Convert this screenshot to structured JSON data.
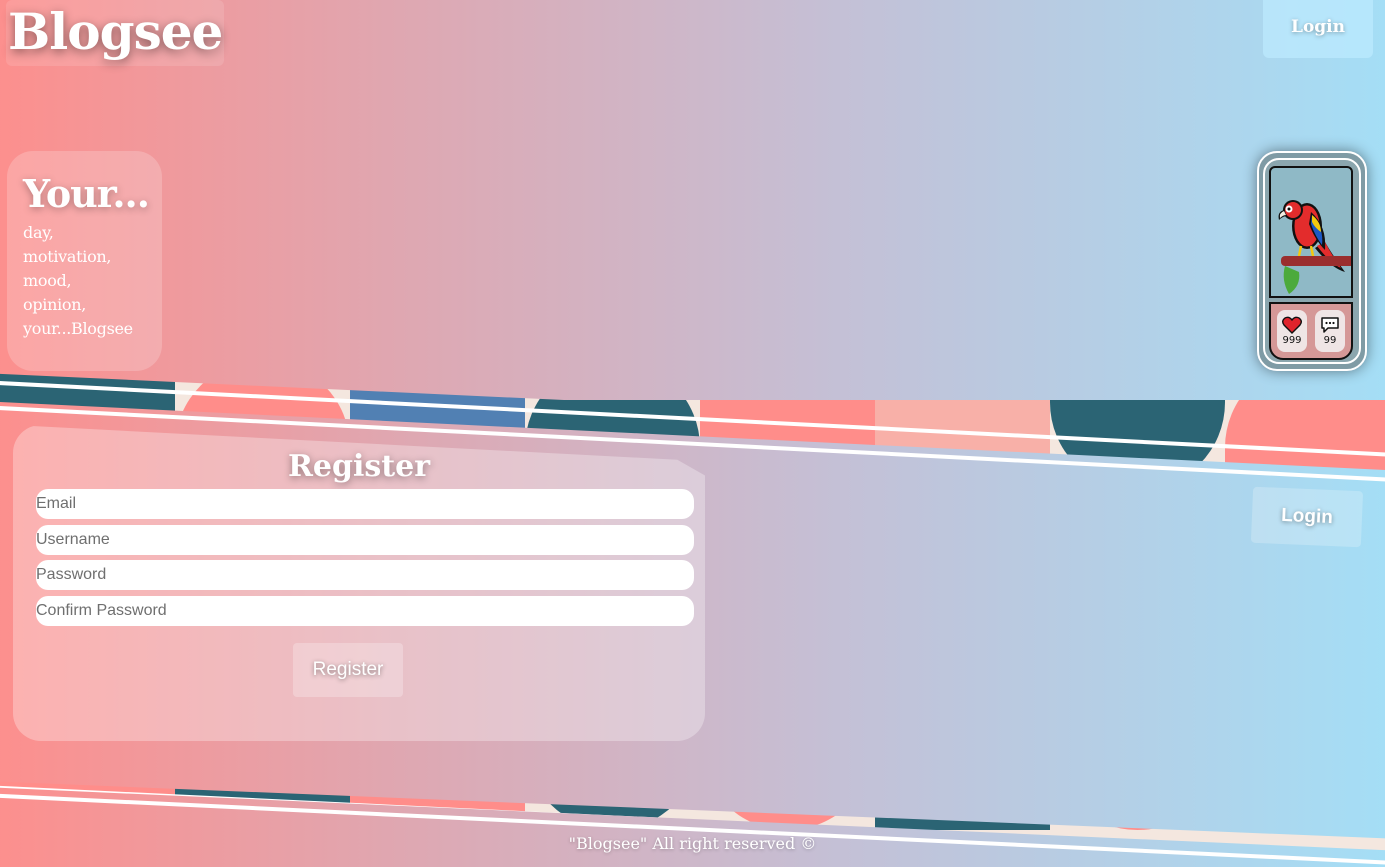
{
  "header": {
    "logo_text": "Blogsee",
    "login_label": "Login"
  },
  "intro": {
    "heading": "Your...",
    "items": [
      "day,",
      "motivation,",
      "mood,",
      "opinion,",
      "your...Blogsee"
    ]
  },
  "post_widget": {
    "image_icon": "parrot-icon",
    "likes": "999",
    "comments": "99",
    "like_icon": "heart-icon",
    "comment_icon": "speech-bubble-icon"
  },
  "register_form": {
    "title": "Register",
    "fields": {
      "email_placeholder": "Email",
      "username_placeholder": "Username",
      "password_placeholder": "Password",
      "confirm_placeholder": "Confirm Password"
    },
    "submit_label": "Register"
  },
  "side_login_label": "Login",
  "footer": {
    "text": "\"Blogsee\" All right reserved ©"
  },
  "colors": {
    "coral": "#ff8d8a",
    "teal": "#2b6474",
    "steel_blue": "#5180b3",
    "peach": "#f8b0a8",
    "sky": "#a2e0f8",
    "cream": "#f4e7df"
  }
}
